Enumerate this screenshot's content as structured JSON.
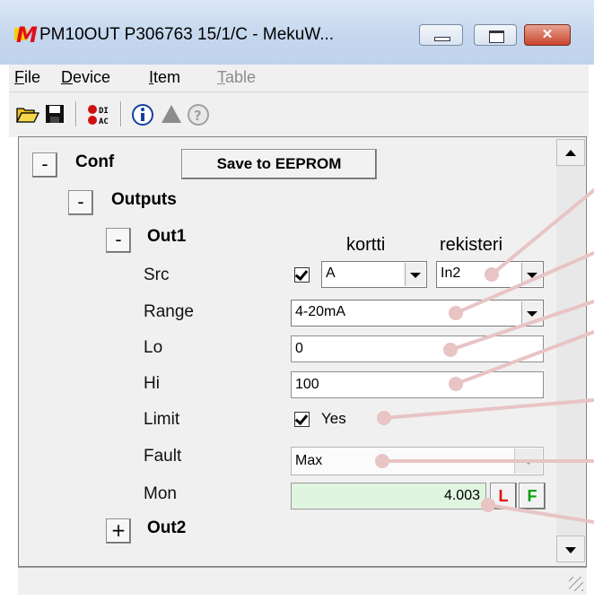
{
  "window": {
    "title": "PM10OUT P306763 15/1/C - MekuW...",
    "app_icon_letter": "M",
    "min_glyph": "",
    "max_glyph": "",
    "close_glyph": "✕"
  },
  "menu": {
    "items": [
      {
        "accel": "F",
        "rest": "ile",
        "disabled": false
      },
      {
        "accel": "D",
        "rest": "evice",
        "disabled": false
      },
      {
        "accel": "I",
        "rest": "tem",
        "disabled": false
      },
      {
        "accel": "T",
        "rest": "able",
        "disabled": true
      }
    ]
  },
  "toolbar": {
    "icons": [
      "open-folder-icon",
      "save-disk-icon",
      "di-ac-io-icon",
      "info-icon",
      "warning-triangle-icon",
      "help-icon"
    ],
    "io_icon_text_top": "DI",
    "io_icon_text_bottom": "AC"
  },
  "tree": {
    "conf": {
      "toggle": "-",
      "label": "Conf"
    },
    "save_button": "Save to EEPROM",
    "outputs": {
      "toggle": "-",
      "label": "Outputs"
    },
    "out1": {
      "toggle": "-",
      "label": "Out1"
    },
    "out2": {
      "toggle": "+",
      "label": "Out2"
    }
  },
  "columns": {
    "kortti": "kortti",
    "rekisteri": "rekisteri"
  },
  "fields": {
    "src": {
      "label": "Src",
      "enabled": true,
      "card": "A",
      "register": "In2"
    },
    "range": {
      "label": "Range",
      "value": "4-20mA"
    },
    "lo": {
      "label": "Lo",
      "value": "0"
    },
    "hi": {
      "label": "Hi",
      "value": "100"
    },
    "limit": {
      "label": "Limit",
      "checked": true,
      "text": "Yes"
    },
    "fault": {
      "label": "Fault",
      "value": "Max"
    },
    "mon": {
      "label": "Mon",
      "value": "4.003",
      "l_button": "L",
      "f_button": "F"
    }
  },
  "colors": {
    "annotation": "#e8c4c4",
    "mon_background": "#dff5df",
    "l_color": "#e01010",
    "f_color": "#0aa00a"
  }
}
